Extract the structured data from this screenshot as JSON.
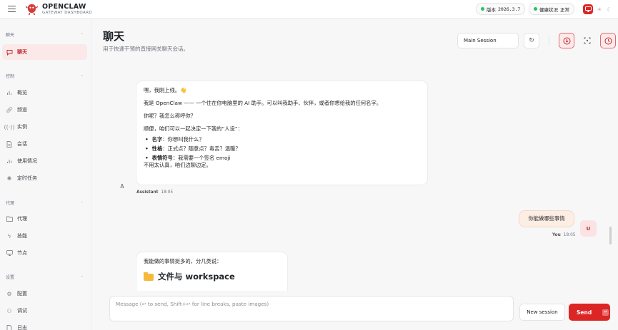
{
  "brand": {
    "title": "OPENCLAW",
    "subtitle": "GATEWAY DASHBOARD"
  },
  "status": {
    "version_label": "版本",
    "version": "2026.3.7",
    "health_label": "健康状况",
    "health_value": "正常"
  },
  "sidebar": {
    "sections": [
      {
        "label": "聊天",
        "items": [
          {
            "label": "聊天",
            "icon": "message-square-icon",
            "active": true
          }
        ]
      },
      {
        "label": "控制",
        "items": [
          {
            "label": "概览",
            "icon": "bar-chart-icon"
          },
          {
            "label": "频道",
            "icon": "link-icon"
          },
          {
            "label": "实例",
            "icon": "radio-icon"
          },
          {
            "label": "会话",
            "icon": "file-text-icon"
          },
          {
            "label": "使用情况",
            "icon": "usage-bars-icon"
          },
          {
            "label": "定时任务",
            "icon": "loader-icon"
          }
        ]
      },
      {
        "label": "代理",
        "items": [
          {
            "label": "代理",
            "icon": "folder-icon"
          },
          {
            "label": "技能",
            "icon": "zap-icon"
          },
          {
            "label": "节点",
            "icon": "monitor-icon"
          }
        ]
      },
      {
        "label": "设置",
        "items": [
          {
            "label": "配置",
            "icon": "settings-icon"
          },
          {
            "label": "调试",
            "icon": "bug-icon"
          },
          {
            "label": "日志",
            "icon": "log-icon"
          }
        ]
      }
    ]
  },
  "header": {
    "title": "聊天",
    "subtitle": "用于快速干预的直接网关聊天会话。",
    "session_select": "Main Session"
  },
  "chat": {
    "assistant_avatar": "A",
    "user_avatar": "U",
    "msg1": {
      "line1": "嘿，我刚上线。👋",
      "line2": "我是 OpenClaw —— 一个住在你电脑里的 AI 助手。可以叫我助手、伙伴，或者你想给我的任何名字。",
      "line3": "你呢？我怎么称呼你？",
      "line4": "顺便，咱们可以一起决定一下我的“人设”：",
      "b1_label": "名字",
      "b1_text": "：你想叫我什么？",
      "b2_label": "性格",
      "b2_text": "：正式点？随意点？毒舌？温暖？",
      "b3_label": "表情符号",
      "b3_text": "：我需要一个签名 emoji",
      "line5": "不用太认真，咱们边聊边定。",
      "sender": "Assistant",
      "time": "18:05"
    },
    "msg2": {
      "text": "你能做哪些事情",
      "sender": "You",
      "time": "18:05"
    },
    "msg3": {
      "line1": "我能做的事情挺多的，分几类说：",
      "heading": "文件与 workspace"
    }
  },
  "composer": {
    "placeholder": "Message (↩ to send, Shift+↩ for line breaks, paste images)",
    "new_session": "New session",
    "send": "Send"
  },
  "colors": {
    "accent": "#dc2626",
    "active_bg": "#fbe9e9",
    "user_bubble": "#fdeee4",
    "health": "#22c55e"
  }
}
